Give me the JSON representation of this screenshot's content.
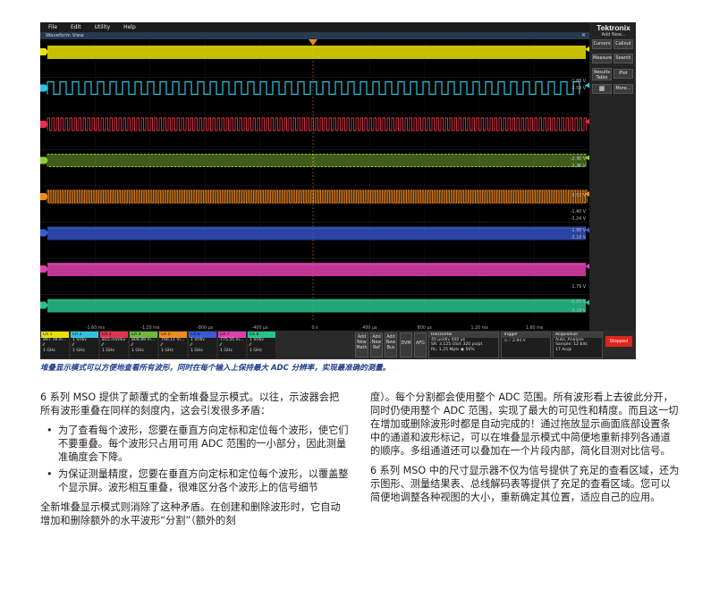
{
  "scope": {
    "menu": [
      "File",
      "Edit",
      "Utility",
      "Help"
    ],
    "window_title": "Waveform View",
    "brand": "Tektronix",
    "add_new": "Add New...",
    "right_buttons": [
      {
        "id": "cursors",
        "label": "Cursors"
      },
      {
        "id": "callout",
        "label": "Callout"
      },
      {
        "id": "measure",
        "label": "Measure"
      },
      {
        "id": "search",
        "label": "Search"
      },
      {
        "id": "results-table",
        "label": "Results Table"
      },
      {
        "id": "plot",
        "label": "Plot"
      },
      {
        "id": "more",
        "label": "More..."
      }
    ],
    "time_ticks": [
      "-1.60 ms",
      "-1.20 ms",
      "-800 µs",
      "-400 µs",
      "0 s",
      "400 µs",
      "800 µs",
      "1.20 ms",
      "1.60 ms"
    ],
    "lane_readouts": [
      "-1.88 V",
      "-3.59 V",
      "-2.80 V",
      "-3.38 V",
      "1.63 V",
      "-1.40 V",
      "-3.24 V",
      "-1.98 V",
      "-3.18 V",
      "1.79 V",
      "-1.55 V",
      "-3.18 V"
    ],
    "channels": [
      {
        "name": "Ch 1",
        "color": "#e8e000",
        "l1": "897.78 m...",
        "l2": "1 GHz"
      },
      {
        "name": "Ch 2",
        "color": "#2ec4e0",
        "l1": "1 V/div",
        "l2": "1 GHz"
      },
      {
        "name": "Ch 3",
        "color": "#e3334f",
        "l1": "815 mV/div",
        "l2": "1 GHz"
      },
      {
        "name": "Ch 4",
        "color": "#6fb83a",
        "l1": "808.89 m...",
        "l2": "1 GHz"
      },
      {
        "name": "Ch 5",
        "color": "#f08a1d",
        "l1": "796.11 m...",
        "l2": "1 GHz"
      },
      {
        "name": "Ch 6",
        "color": "#3a5ad8",
        "l1": "1 V/div",
        "l2": "1 GHz"
      },
      {
        "name": "Ch 7",
        "color": "#e23fb0",
        "l1": "775.55 m...",
        "l2": "1 GHz"
      },
      {
        "name": "Ch 8",
        "color": "#29c28a",
        "l1": "1 V/div",
        "l2": "1 GHz"
      }
    ],
    "wave_colors": [
      "#e8e000",
      "#2ec4e0",
      "#e3334f",
      "#8fce3a",
      "#f08a1d",
      "#3a5ad8",
      "#e23fb0",
      "#29c28a"
    ],
    "mini_buttons": [
      "Add New Math",
      "Add New Ref",
      "Add New Bus",
      "DVM",
      "AFG"
    ],
    "horizontal": {
      "title": "Horizontal",
      "l1": "40 µs/div    400 µs",
      "l2": "SR: 3.125 GS/s  320 ps/pt",
      "l3": "RL: 1.25 Mpts  ◉ 50%"
    },
    "trigger": {
      "title": "Trigger",
      "l1": "⊐  ⟋  2.94 V"
    },
    "acquisition": {
      "title": "Acquisition",
      "l1": "Auto,        Analyze",
      "l2": "Sample: 12 bits",
      "l3": "17 Acqs"
    },
    "stopped": "Stopped"
  },
  "caption": "堆叠显示模式可以方便地查看所有波形，同时在每个输入上保持最大 ADC 分辨率，实现最准确的测量。",
  "left": {
    "p1": "6 系列 MSO 提供了颠覆式的全新堆叠显示模式。以往，示波器会把所有波形重叠在同样的刻度内，这会引发很多矛盾：",
    "bullets": [
      "为了查看每个波形，您要在垂直方向定标和定位每个波形，使它们不要重叠。每个波形只占用可用 ADC 范围的一小部分，因此测量准确度会下降。",
      "为保证测量精度，您要在垂直方向定标和定位每个波形，以覆盖整个显示屏。波形相互重叠，很难区分各个波形上的信号细节"
    ],
    "p2": "全新堆叠显示模式则消除了这种矛盾。在创建和删除波形时，它自动增加和删除额外的水平波形“分割”（额外的刻"
  },
  "right": {
    "p1": "度）。每个分割都会使用整个 ADC 范围。所有波形看上去彼此分开，同时仍使用整个 ADC 范围，实现了最大的可见性和精度。而且这一切在增加或删除波形时都是自动完成的！通过拖放显示画面底部设置条中的通道和波形标记，可以在堆叠显示模式中简便地重新排列各通道的顺序。多组通道还可以叠加在一个片段内部，简化目测对比信号。",
    "p2": "6 系列 MSO 中的尺寸显示器不仅为信号提供了充足的查看区域，还为示图形、测量结果表、总线解码表等提供了充足的查看区域。您可以简便地调整各种视图的大小，重新确定其位置，适应自己的应用。"
  }
}
